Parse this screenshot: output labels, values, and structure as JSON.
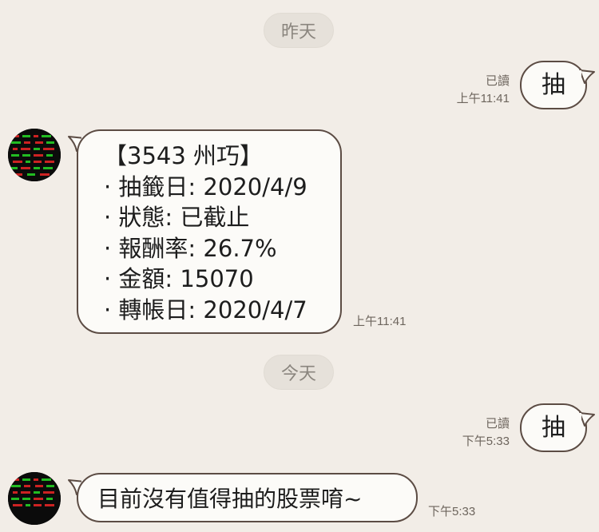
{
  "date_separators": {
    "yesterday": "昨天",
    "today": "今天"
  },
  "outgoing_1": {
    "text": "抽",
    "read": "已讀",
    "time": "上午11:41"
  },
  "incoming_1": {
    "lines": [
      "【3543 州巧】",
      "· 抽籤日: 2020/4/9",
      "· 狀態: 已截止",
      "· 報酬率: 26.7%",
      "· 金額: 15070",
      "· 轉帳日: 2020/4/7"
    ],
    "time": "上午11:41"
  },
  "outgoing_2": {
    "text": "抽",
    "read": "已讀",
    "time": "下午5:33"
  },
  "incoming_2": {
    "text": "目前沒有值得抽的股票唷~",
    "time": "下午5:33"
  },
  "colors": {
    "background": "#f2ede7",
    "bubble": "#fcfbf8",
    "border": "#5c4c44",
    "meta": "#6d655d"
  }
}
